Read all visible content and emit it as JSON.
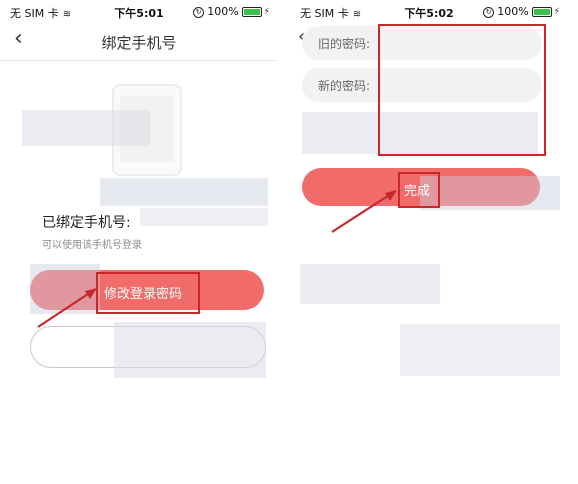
{
  "status_left": {
    "carrier": "无 SIM 卡",
    "time": "下午5:01",
    "battery": "100%"
  },
  "status_right": {
    "carrier": "无 SIM 卡",
    "time": "下午5:02",
    "battery": "100%"
  },
  "left_screen": {
    "title": "绑定手机号",
    "bound_label": "已绑定手机号:",
    "hint": "可以使用该手机号登录",
    "change_password_button": "修改登录密码"
  },
  "right_screen": {
    "old_password_label": "旧的密码:",
    "new_password_label": "新的密码:",
    "done_button": "完成"
  },
  "colors": {
    "accent": "#f26b6b",
    "annotation": "#c8282a",
    "battery": "#3cc14a"
  },
  "icons": {
    "back": "chevron-left-icon",
    "wifi": "wifi-icon",
    "lock": "orientation-lock-icon",
    "battery": "battery-icon",
    "charging": "bolt-icon",
    "arrow": "annotation-arrow-icon"
  }
}
